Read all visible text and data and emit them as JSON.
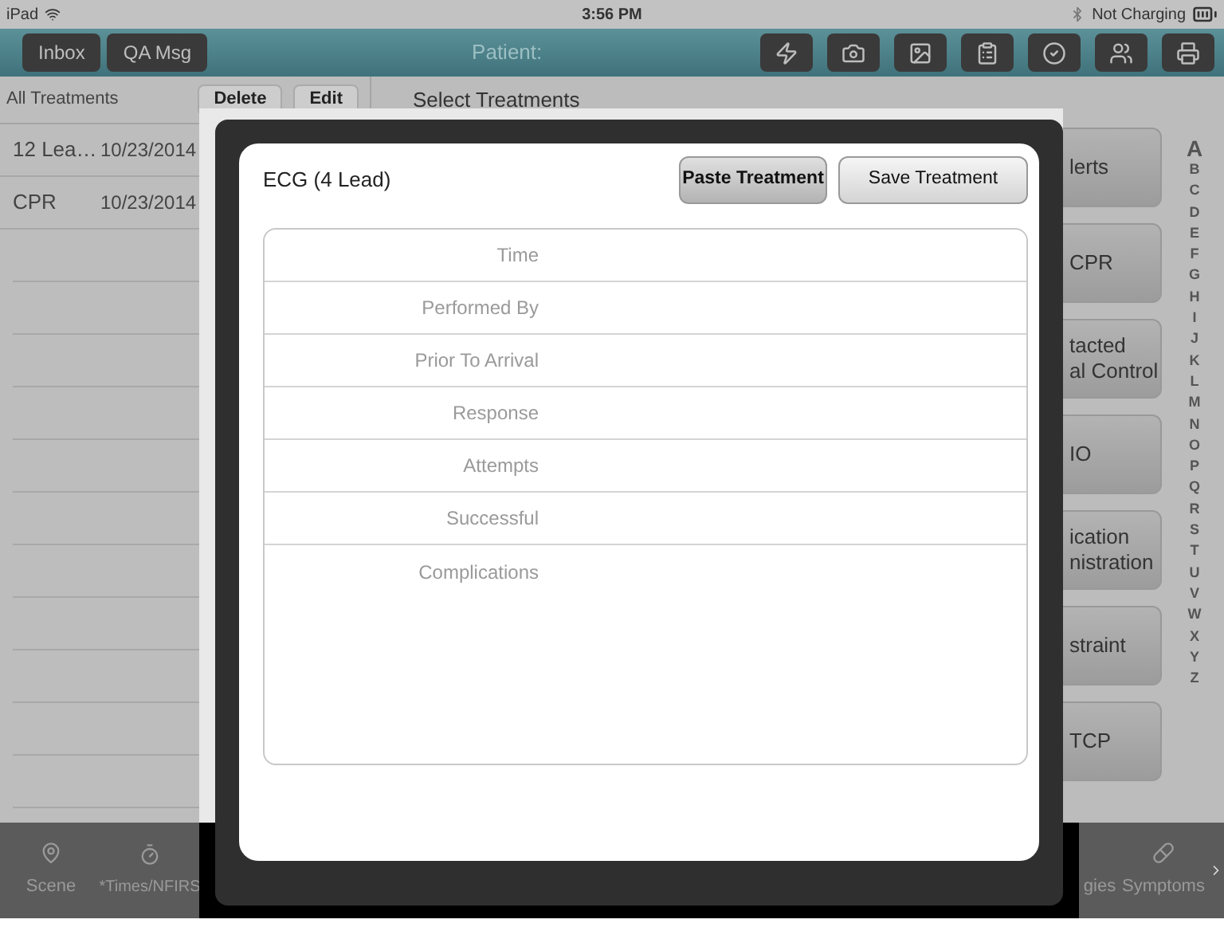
{
  "status_bar": {
    "device": "iPad",
    "time": "3:56 PM",
    "charging": "Not Charging"
  },
  "nav_bar": {
    "buttons": [
      "Inbox",
      "QA Msg"
    ],
    "title": "Patient:"
  },
  "treatments_list": {
    "title": "All Treatments",
    "actions": [
      "Delete",
      "Edit"
    ],
    "rows": [
      {
        "name": "12 Lea…",
        "date": "10/23/2014"
      },
      {
        "name": "CPR",
        "date": "10/23/2014"
      }
    ]
  },
  "select_panel": {
    "title": "Select Treatments",
    "buttons": [
      {
        "lines": [
          "lerts"
        ]
      },
      {
        "lines": [
          "CPR"
        ]
      },
      {
        "lines": [
          "tacted",
          "al Control"
        ]
      },
      {
        "lines": [
          "IO"
        ]
      },
      {
        "lines": [
          "ication",
          "nistration"
        ]
      },
      {
        "lines": [
          "straint"
        ]
      },
      {
        "lines": [
          "TCP"
        ]
      }
    ],
    "index": [
      "A",
      "B",
      "C",
      "D",
      "E",
      "F",
      "G",
      "H",
      "I",
      "J",
      "K",
      "L",
      "M",
      "N",
      "O",
      "P",
      "Q",
      "R",
      "S",
      "T",
      "U",
      "V",
      "W",
      "X",
      "Y",
      "Z"
    ]
  },
  "tab_bar": {
    "tabs": [
      {
        "label": "Scene",
        "kind": "pin"
      },
      {
        "label": "*Times/NFIRS",
        "kind": "clock"
      },
      {
        "label": "gies",
        "kind": "none"
      },
      {
        "label": "Symptoms",
        "kind": "pill"
      }
    ]
  },
  "dialog": {
    "title": "ECG (4 Lead)",
    "buttons": [
      {
        "label": "Paste Treatment",
        "bold": true
      },
      {
        "label": "Save Treatment",
        "bold": false
      }
    ],
    "fields": [
      "Time",
      "Performed By",
      "Prior To Arrival",
      "Response",
      "Attempts",
      "Successful",
      "Complications"
    ]
  }
}
